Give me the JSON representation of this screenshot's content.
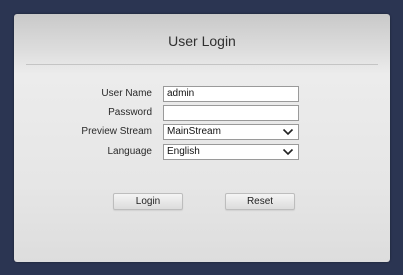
{
  "login": {
    "title": "User Login",
    "fields": {
      "username": {
        "label": "User Name",
        "value": "admin"
      },
      "password": {
        "label": "Password",
        "value": ""
      },
      "preview_stream": {
        "label": "Preview Stream",
        "value": "MainStream"
      },
      "language": {
        "label": "Language",
        "value": "English"
      }
    },
    "buttons": {
      "login": "Login",
      "reset": "Reset"
    }
  },
  "icons": {
    "select_arrow": "chevron-down-icon"
  },
  "colors": {
    "frame": "#2b3552",
    "card": "#e6e6e6"
  }
}
